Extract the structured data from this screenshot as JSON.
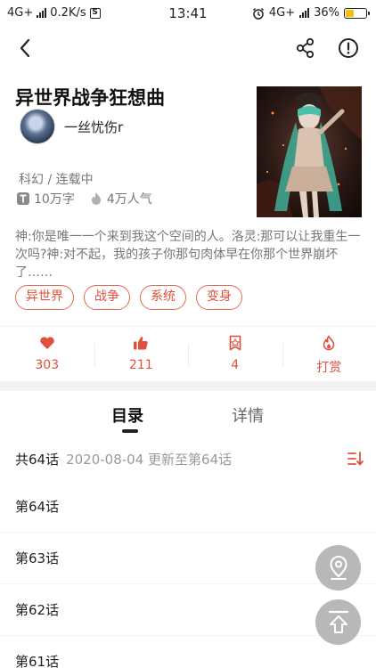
{
  "status_bar": {
    "network": "4G+",
    "speed": "0.2K/s",
    "s_badge": "S",
    "time": "13:41",
    "network_right": "4G+",
    "battery_percent": "36%",
    "battery_level": 0.36
  },
  "nav": {
    "back_icon": "chevron-left-icon",
    "share_icon": "share-icon",
    "info_icon": "info-icon"
  },
  "book": {
    "title": "异世界战争狂想曲",
    "author": "一丝忧伤r",
    "genre": "科幻 / 连载中",
    "word_count": "10万字",
    "popularity": "4万人气",
    "description": "神:你是唯一一个来到我这个空间的人。洛灵:那可以让我重生一次吗?神:对不起，我的孩子你那句肉体早在你那个世界崩坏了……",
    "tags": [
      "异世界",
      "战争",
      "系统",
      "变身"
    ]
  },
  "actions": [
    {
      "icon": "heart-icon",
      "label": "303"
    },
    {
      "icon": "thumbs-up-icon",
      "label": "211"
    },
    {
      "icon": "bookmark-ticket-icon",
      "label": "4"
    },
    {
      "icon": "flame-icon",
      "label": "打赏"
    }
  ],
  "tabs": {
    "catalog": "目录",
    "detail": "详情"
  },
  "catalog": {
    "count": "共64话",
    "update": "2020-08-04 更新至第64话",
    "chapters": [
      "第64话",
      "第63话",
      "第62话",
      "第61话"
    ]
  },
  "colors": {
    "accent": "#e0503c",
    "fab": "#b8b8b8"
  }
}
